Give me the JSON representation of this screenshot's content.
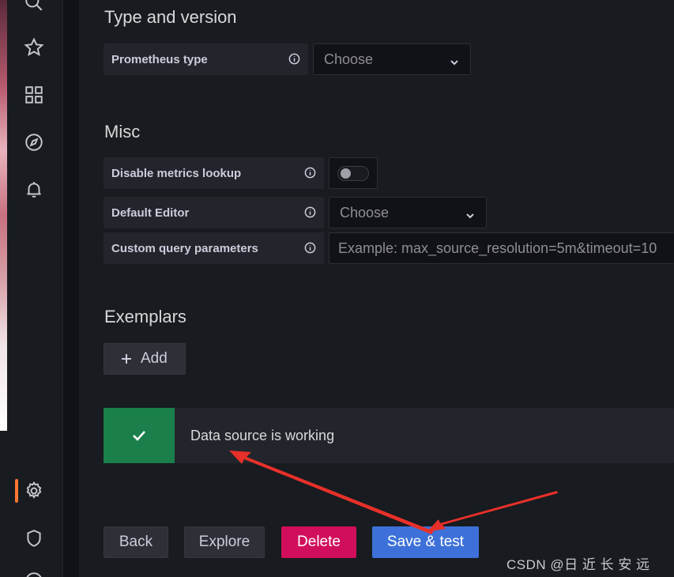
{
  "sidebar": {
    "icons": [
      "search-icon",
      "star-icon",
      "dashboards-icon",
      "explore-icon",
      "alerting-icon",
      "gear-icon",
      "shield-icon"
    ],
    "accent": "#ff7733"
  },
  "type_version": {
    "title": "Type and version",
    "prometheus_type_label": "Prometheus type",
    "prometheus_type_value": "Choose"
  },
  "misc": {
    "title": "Misc",
    "disable_metrics_label": "Disable metrics lookup",
    "default_editor_label": "Default Editor",
    "default_editor_value": "Choose",
    "custom_query_label": "Custom query parameters",
    "custom_query_placeholder": "Example: max_source_resolution=5m&timeout=10"
  },
  "exemplars": {
    "title": "Exemplars",
    "add_label": "Add"
  },
  "alert": {
    "message": "Data source is working",
    "color": "#1a7f4b"
  },
  "actions": {
    "back": "Back",
    "explore": "Explore",
    "delete": "Delete",
    "save_test": "Save & test",
    "delete_color": "#d10e5c",
    "save_color": "#3d71d9"
  },
  "watermark": "CSDN @日 近 长 安 远"
}
